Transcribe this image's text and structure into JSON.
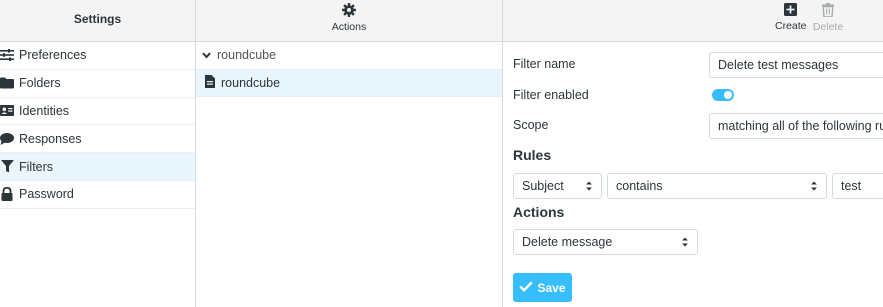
{
  "settings_panel": {
    "title": "Settings",
    "items": [
      {
        "label": "Preferences",
        "icon": "sliders-icon"
      },
      {
        "label": "Folders",
        "icon": "folder-icon"
      },
      {
        "label": "Identities",
        "icon": "id-card-icon"
      },
      {
        "label": "Responses",
        "icon": "comment-icon"
      },
      {
        "label": "Filters",
        "icon": "filter-icon",
        "selected": true
      },
      {
        "label": "Password",
        "icon": "lock-icon"
      }
    ]
  },
  "filters_panel": {
    "actions_label": "Actions",
    "filter_set": "roundcube",
    "filters": [
      {
        "label": "roundcube",
        "selected": true
      }
    ]
  },
  "toolbar": {
    "create_label": "Create",
    "delete_label": "Delete"
  },
  "filter_form": {
    "name_label": "Filter name",
    "name_value": "Delete test messages",
    "enabled_label": "Filter enabled",
    "enabled": true,
    "scope_label": "Scope",
    "scope_value": "matching all of the following rules",
    "rules_heading": "Rules",
    "rule": {
      "header": "Subject",
      "operator": "contains",
      "value": "test"
    },
    "actions_heading": "Actions",
    "action": "Delete message",
    "save_label": "Save"
  },
  "colors": {
    "accent": "#37beff",
    "selected_bg": "#eaf6fd",
    "header_bg": "#f4f4f4",
    "border": "#d4dbde"
  }
}
